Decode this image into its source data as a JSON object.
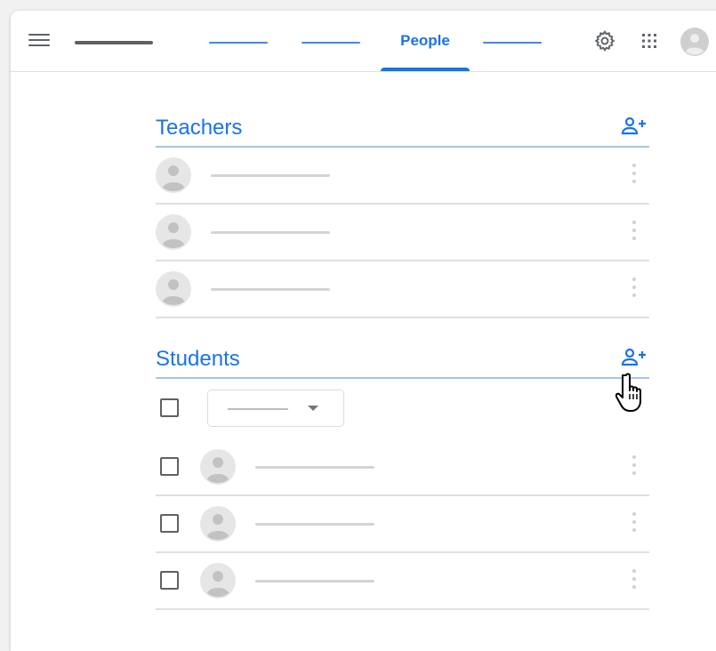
{
  "header": {
    "active_tab_label": "People",
    "accent_color": "#1a73e8",
    "icons": [
      "menu-icon",
      "settings-gear-icon",
      "apps-grid-icon",
      "account-avatar-icon"
    ]
  },
  "teachers": {
    "title": "Teachers",
    "add_icon": "add-person-icon",
    "rows": 3
  },
  "students": {
    "title": "Students",
    "add_icon": "add-person-icon",
    "rows": 3
  },
  "pointer_icon": "hand-pointer-icon"
}
